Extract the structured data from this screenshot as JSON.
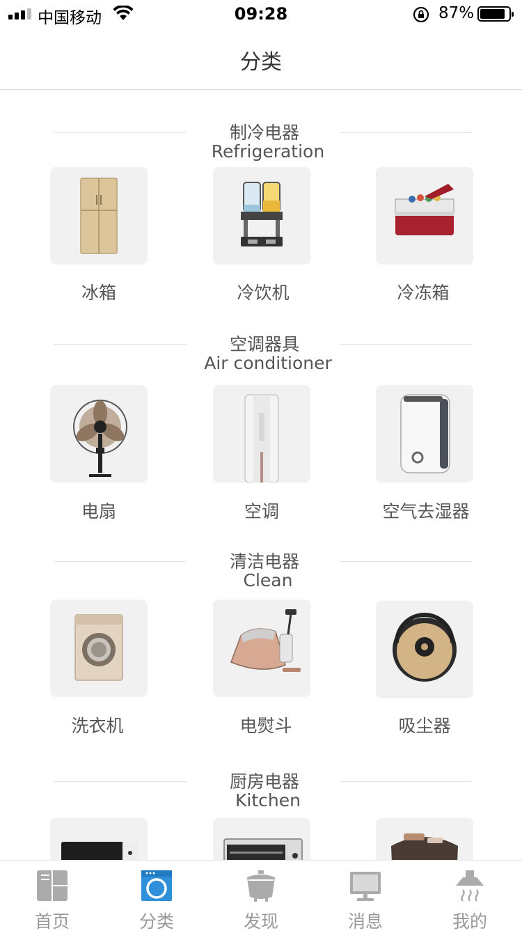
{
  "status_bar": {
    "carrier": "中国移动",
    "time": "09:28",
    "battery_percent": "87%",
    "battery_level": 0.87
  },
  "nav": {
    "title": "分类"
  },
  "sections": [
    {
      "title_cn": "制冷电器",
      "title_en": "Refrigeration",
      "items": [
        {
          "label": "冰箱",
          "icon": "refrigerator-icon"
        },
        {
          "label": "冷饮机",
          "icon": "drink-dispenser-icon"
        },
        {
          "label": "冷冻箱",
          "icon": "cooler-box-icon"
        }
      ]
    },
    {
      "title_cn": "空调器具",
      "title_en": "Air conditioner",
      "items": [
        {
          "label": "电扇",
          "icon": "electric-fan-icon"
        },
        {
          "label": "空调",
          "icon": "air-conditioner-icon"
        },
        {
          "label": "空气去湿器",
          "icon": "dehumidifier-icon"
        }
      ]
    },
    {
      "title_cn": "清洁电器",
      "title_en": "Clean",
      "items": [
        {
          "label": "洗衣机",
          "icon": "washing-machine-icon"
        },
        {
          "label": "电熨斗",
          "icon": "garment-steamer-icon"
        },
        {
          "label": "吸尘器",
          "icon": "robot-vacuum-icon"
        }
      ]
    },
    {
      "title_cn": "厨房电器",
      "title_en": "Kitchen",
      "items": [
        {
          "label": "",
          "icon": "microwave-icon"
        },
        {
          "label": "",
          "icon": "oven-icon"
        },
        {
          "label": "",
          "icon": "rice-cooker-icon"
        }
      ]
    }
  ],
  "tabs": [
    {
      "label": "首页",
      "icon": "home-fridge-icon"
    },
    {
      "label": "分类",
      "icon": "category-washer-icon",
      "active": true
    },
    {
      "label": "发现",
      "icon": "discover-cooker-icon"
    },
    {
      "label": "消息",
      "icon": "message-monitor-icon"
    },
    {
      "label": "我的",
      "icon": "profile-hood-icon"
    }
  ],
  "colors": {
    "background": "#ffffff",
    "tile": "#f1f1f1",
    "text": "#555555",
    "tab_inactive": "#aaaaaa",
    "tab_active": "#2f8fd8"
  }
}
